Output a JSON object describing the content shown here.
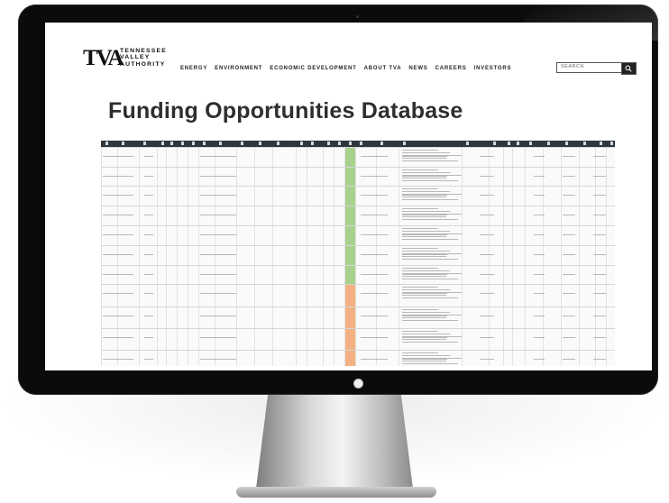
{
  "page": {
    "title": "Funding Opportunities Database"
  },
  "brand": {
    "logo_mark": "TVA",
    "name_lines": [
      "TENNESSEE",
      "VALLEY",
      "AUTHORITY"
    ]
  },
  "nav": {
    "items": [
      "ENERGY",
      "ENVIRONMENT",
      "ECONOMIC DEVELOPMENT",
      "ABOUT TVA",
      "NEWS",
      "CAREERS",
      "INVESTORS"
    ]
  },
  "search": {
    "placeholder": "SEARCH",
    "icon": "search-icon"
  },
  "colors": {
    "header_bar": "#2f3640",
    "status_green": "#a8d08d",
    "status_orange": "#f4b183",
    "title_text": "#2e2e2e",
    "bezel": "#0b0b0c"
  }
}
